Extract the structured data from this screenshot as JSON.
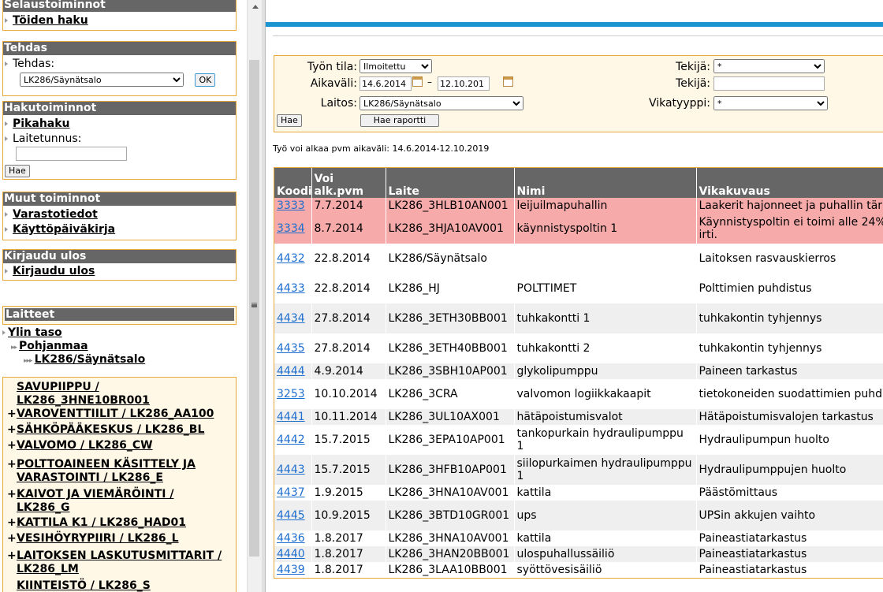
{
  "left": {
    "selaus": {
      "title": "Selaustoiminnot",
      "items": [
        "Töiden haku"
      ]
    },
    "tehdas": {
      "title": "Tehdas",
      "label": "Tehdas:",
      "selected": "LK286/Säynätsalo",
      "ok": "OK"
    },
    "haku": {
      "title": "Hakutoiminnot",
      "pikahaku": "Pikahaku",
      "laitetunnus_label": "Laitetunnus:",
      "laitetunnus_value": "",
      "hae": "Hae"
    },
    "muut": {
      "title": "Muut toiminnot",
      "items": [
        "Varastotiedot",
        "Käyttöpäiväkirja"
      ]
    },
    "kirjaudu": {
      "title": "Kirjaudu ulos",
      "item": "Kirjaudu ulos"
    },
    "laitteet": {
      "title": "Laitteet"
    },
    "tree": {
      "level0": "Ylin taso",
      "level1": "Pohjanmaa",
      "level2": "LK286/Säynätsalo"
    },
    "groups": [
      {
        "pm": "",
        "line1": "SAVUPIIPPU /",
        "line2": "LK286_3HNE10BR001"
      },
      {
        "pm": "+",
        "line1": "VAROVENTTIILIT / LK286_AA100",
        "line2": ""
      },
      {
        "pm": "+",
        "line1": "SÄHKÖPÄÄKESKUS / LK286_BL",
        "line2": ""
      },
      {
        "pm": "+",
        "line1": "VALVOMO / LK286_CW",
        "line2": ""
      },
      {
        "pm": "+",
        "line1": "POLTTOAINEEN KÄSITTELY JA",
        "line2": "VARASTOINTI / LK286_E"
      },
      {
        "pm": "+",
        "line1": "KAIVOT JA VIEMÄRÖINTI /",
        "line2": "LK286_G"
      },
      {
        "pm": "+",
        "line1": "KATTILA K1 / LK286_HAD01",
        "line2": ""
      },
      {
        "pm": "+",
        "line1": "VESIHÖYRYPIIRI / LK286_L",
        "line2": ""
      },
      {
        "pm": "+",
        "line1": "LAITOKSEN LASKUTUSMITTARIT /",
        "line2": "LK286_LM"
      },
      {
        "pm": "",
        "line1": "KIINTEISTÖ / LK286_S",
        "line2": ""
      }
    ]
  },
  "filter": {
    "tila_label": "Työn tila:",
    "tila_value": "Ilmoitettu",
    "aikavali_label": "Aikaväli:",
    "date_from": "14.6.2014",
    "dash": "–",
    "date_to": "12.10.201",
    "laitos_label": "Laitos:",
    "laitos_value": "LK286/Säynätsalo",
    "tekija1_label": "Tekijä:",
    "tekija1_value": "*",
    "tekija2_label": "Tekijä:",
    "tekija2_value": "",
    "vikatyyppi_label": "Vikatyyppi:",
    "vikatyyppi_value": "*",
    "hae": "Hae",
    "raportti": "Hae raportti"
  },
  "note": "Työ voi alkaa pvm aikaväli: 14.6.2014-12.10.2019",
  "table": {
    "headers": [
      "Koodi",
      "Voi alk.pvm",
      "Laite",
      "Nimi",
      "Vikakuvaus"
    ],
    "rows": [
      {
        "code": "3333",
        "date": "7.7.2014",
        "laite": "LK286_3HLB10AN001",
        "nimi": "leijuilmapuhallin",
        "vika": "Laakerit hajonneet ja puhallin täri",
        "style": "alert",
        "h": 20
      },
      {
        "code": "3334",
        "date": "8.7.2014",
        "laite": "LK286_3HJA10AV001",
        "nimi": "käynnistyspoltin 1",
        "vika": "Käynnistyspoltin ei toimi alle 24% irti.",
        "style": "alert",
        "h": 38
      },
      {
        "code": "4432",
        "date": "22.8.2014",
        "laite": "LK286/Säynätsalo",
        "nimi": "",
        "vika": "Laitoksen rasvauskierros",
        "style": "odd",
        "h": 38
      },
      {
        "code": "4433",
        "date": "22.8.2014",
        "laite": "LK286_HJ",
        "nimi": "POLTTIMET",
        "vika": "Polttimien puhdistus",
        "style": "odd",
        "h": 38
      },
      {
        "code": "4434",
        "date": "27.8.2014",
        "laite": "LK286_3ETH30BB001",
        "nimi": "tuhkakontti 1",
        "vika": "tuhkakontin tyhjennys",
        "style": "even",
        "h": 38
      },
      {
        "code": "4435",
        "date": "27.8.2014",
        "laite": "LK286_3ETH40BB001",
        "nimi": "tuhkakontti 2",
        "vika": "tuhkakontin tyhjennys",
        "style": "odd",
        "h": 38
      },
      {
        "code": "4444",
        "date": "4.9.2014",
        "laite": "LK286_3SBH10AP001",
        "nimi": "glykolipumppu",
        "vika": "Paineen tarkastus",
        "style": "even",
        "h": 20
      },
      {
        "code": "3253",
        "date": "10.10.2014",
        "laite": "LK286_3CRA",
        "nimi": "valvomon logiikkakaapit",
        "vika": "tietokoneiden suodattimien puhdi",
        "style": "odd",
        "h": 38
      },
      {
        "code": "4441",
        "date": "10.11.2014",
        "laite": "LK286_3UL10AX001",
        "nimi": "hätäpoistumisvalot",
        "vika": "Hätäpoistumisvalojen tarkastus",
        "style": "even",
        "h": 20
      },
      {
        "code": "4442",
        "date": "15.7.2015",
        "laite": "LK286_3EPA10AP001",
        "nimi": "tankopurkain hydraulipumppu 1",
        "vika": "Hydraulipumpun huolto",
        "style": "odd",
        "h": 38
      },
      {
        "code": "4443",
        "date": "15.7.2015",
        "laite": "LK286_3HFB10AP001",
        "nimi": "siilopurkaimen hydraulipumppu 1",
        "vika": "Hydraulipumppujen huolto",
        "style": "even",
        "h": 38
      },
      {
        "code": "4437",
        "date": "1.9.2015",
        "laite": "LK286_3HNA10AV001",
        "nimi": "kattila",
        "vika": "Päästömittaus",
        "style": "odd",
        "h": 20
      },
      {
        "code": "4445",
        "date": "10.9.2015",
        "laite": "LK286_3BTD10GR001",
        "nimi": "ups",
        "vika": "UPSin akkujen vaihto",
        "style": "even",
        "h": 38
      },
      {
        "code": "4436",
        "date": "1.8.2017",
        "laite": "LK286_3HNA10AV001",
        "nimi": "kattila",
        "vika": "Paineastiatarkastus",
        "style": "odd",
        "h": 20
      },
      {
        "code": "4440",
        "date": "1.8.2017",
        "laite": "LK286_3HAN20BB001",
        "nimi": "ulospuhallussäiliö",
        "vika": "Paineastiatarkastus",
        "style": "even",
        "h": 20
      },
      {
        "code": "4439",
        "date": "1.8.2017",
        "laite": "LK286_3LAA10BB001",
        "nimi": "syöttövesisäiliö",
        "vika": "Paineastiatarkastus",
        "style": "odd",
        "h": 20
      }
    ]
  }
}
